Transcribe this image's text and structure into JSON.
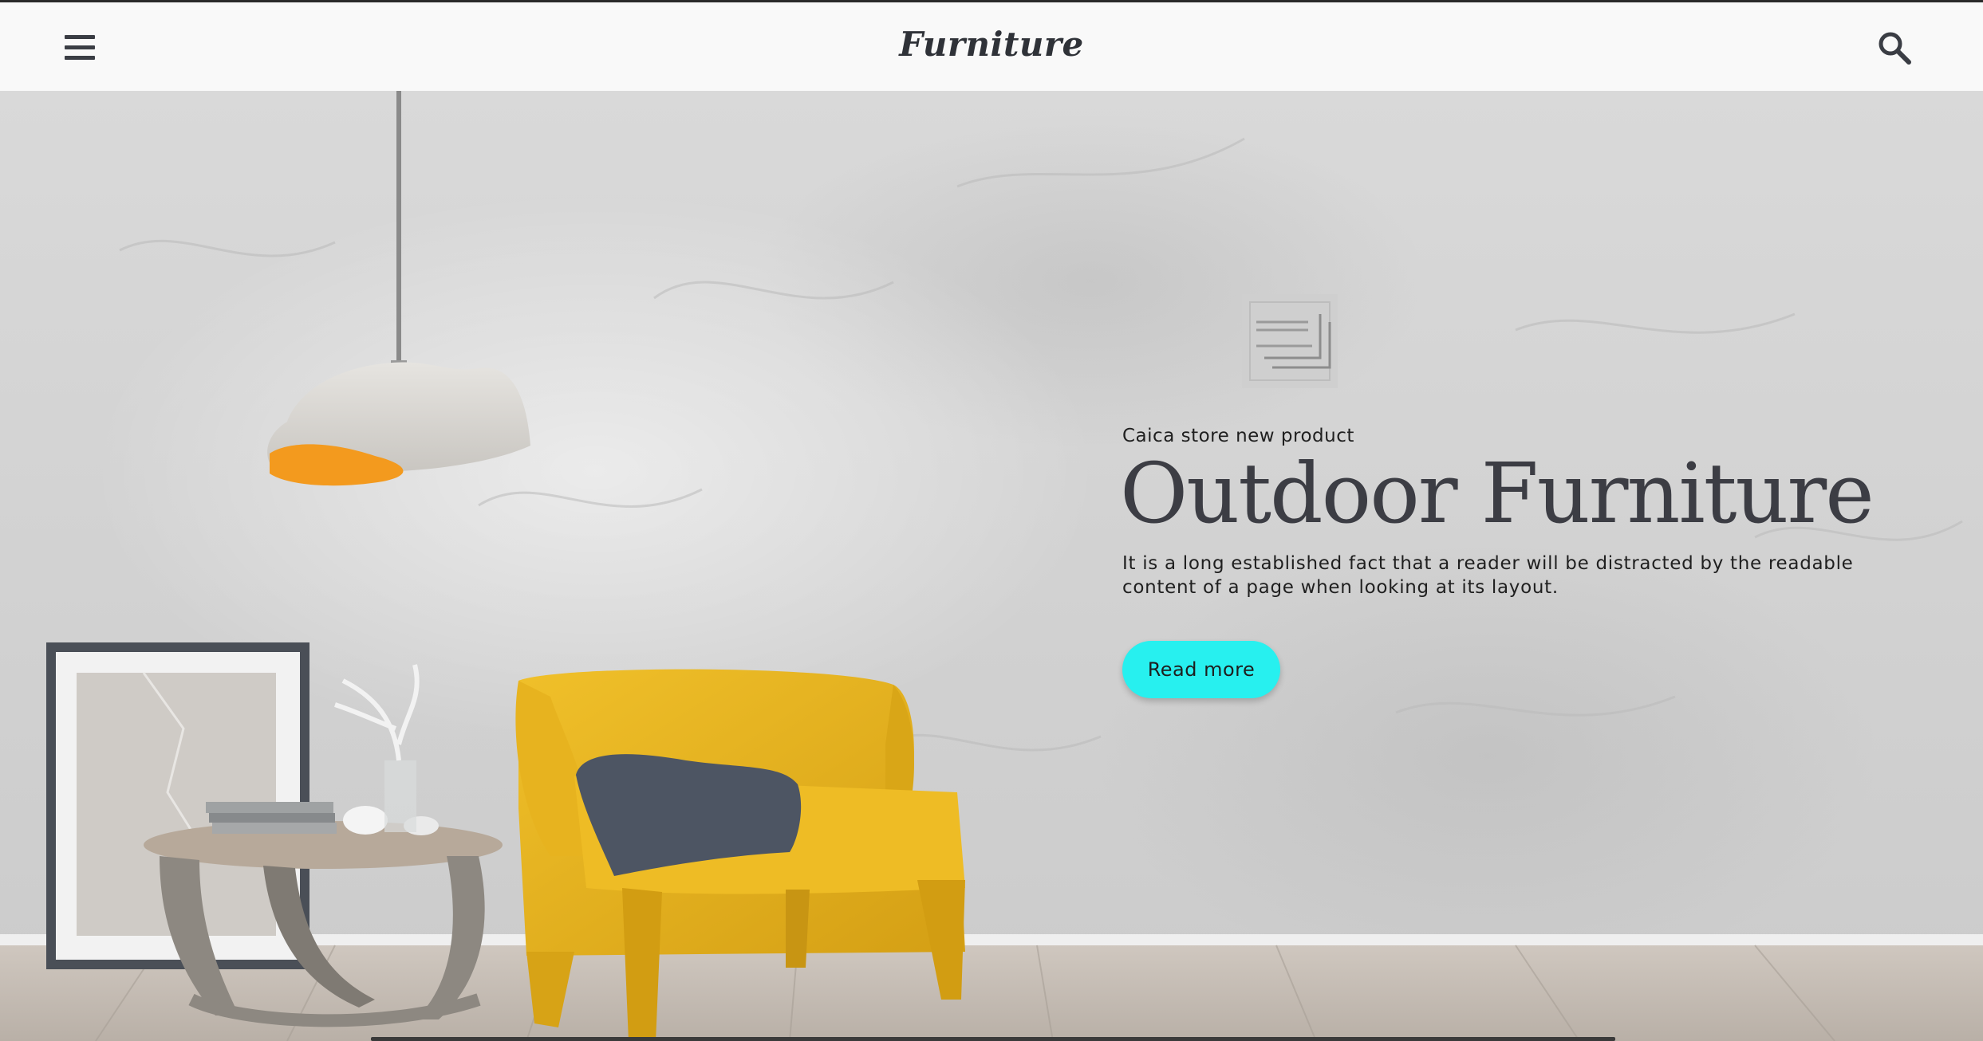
{
  "header": {
    "brand": "Furniture",
    "menu_icon": "hamburger-menu-icon",
    "search_icon": "search-icon"
  },
  "hero": {
    "eyebrow": "Caica store new product",
    "title": "Outdoor Furniture",
    "description": "It is a long established fact that a reader will be distracted by the readable content of a page when looking at its layout.",
    "cta_label": "Read more",
    "cta_color": "#27f0ef",
    "logo_icon": "stacked-frames-logo-icon"
  },
  "colors": {
    "header_bg": "#f9f9f9",
    "text_dark": "#3c3d44",
    "wall": "#d6d6d6",
    "chair": "#e5b21e",
    "pillow": "#4d5563",
    "lamp_inner": "#f39a1e"
  }
}
